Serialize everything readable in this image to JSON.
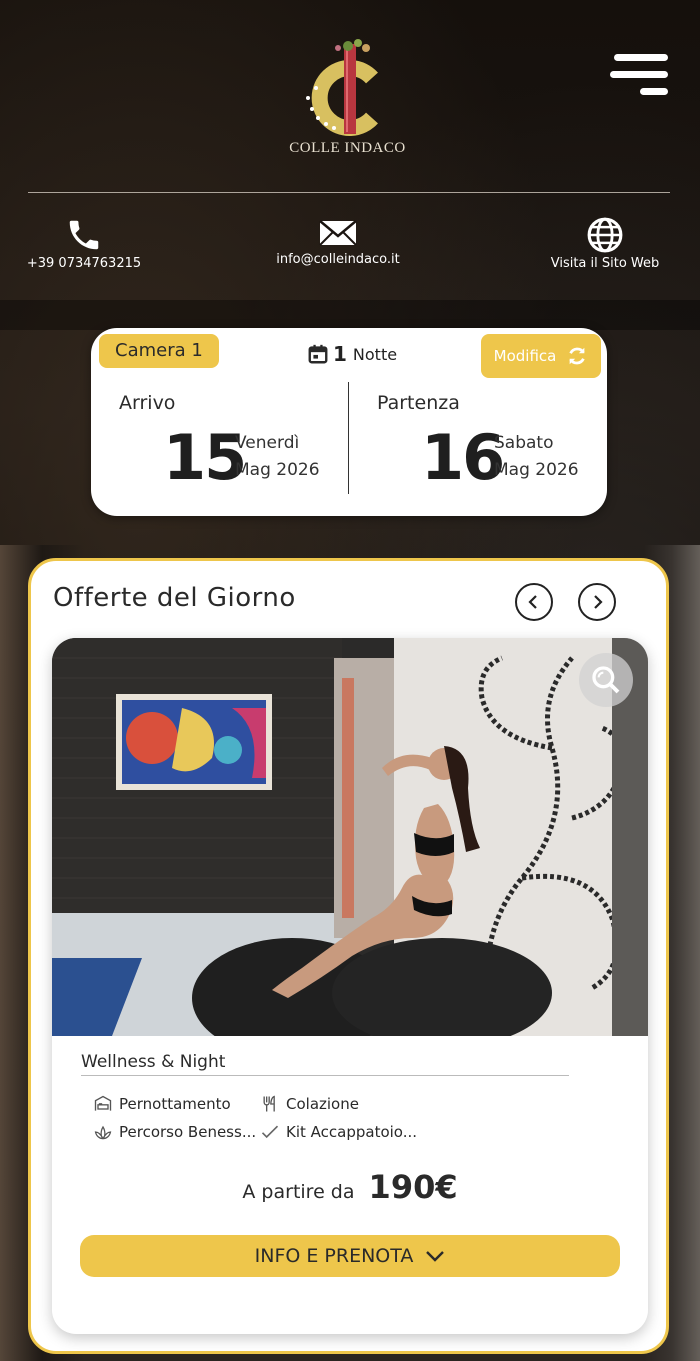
{
  "header": {
    "brand": "COLLE INDACO",
    "contacts": [
      {
        "icon": "phone-icon",
        "label": "+39 0734763215"
      },
      {
        "icon": "mail-icon",
        "label": "info@colleindaco.it"
      },
      {
        "icon": "globe-icon",
        "label": "Visita il Sito Web"
      }
    ]
  },
  "booking": {
    "room_label": "Camera 1",
    "nights_count": "1",
    "nights_label": "Notte",
    "modify_label": "Modifica",
    "arrival": {
      "label": "Arrivo",
      "day": "15",
      "weekday": "Venerdì",
      "month_year": "Mag 2026"
    },
    "departure": {
      "label": "Partenza",
      "day": "16",
      "weekday": "Sabato",
      "month_year": "Mag 2026"
    }
  },
  "offers": {
    "title": "Offerte del Giorno",
    "card": {
      "name": "Wellness & Night",
      "features": [
        "Pernottamento",
        "Colazione",
        "Percorso Beness...",
        "Kit Accappatoio..."
      ],
      "price_prefix": "A partire da",
      "price": "190€",
      "cta_label": "INFO E PRENOTA"
    }
  },
  "colors": {
    "accent": "#eec64b",
    "text": "#2a2a2a",
    "logo_red": "#b8363f",
    "logo_gold": "#d8c060"
  }
}
